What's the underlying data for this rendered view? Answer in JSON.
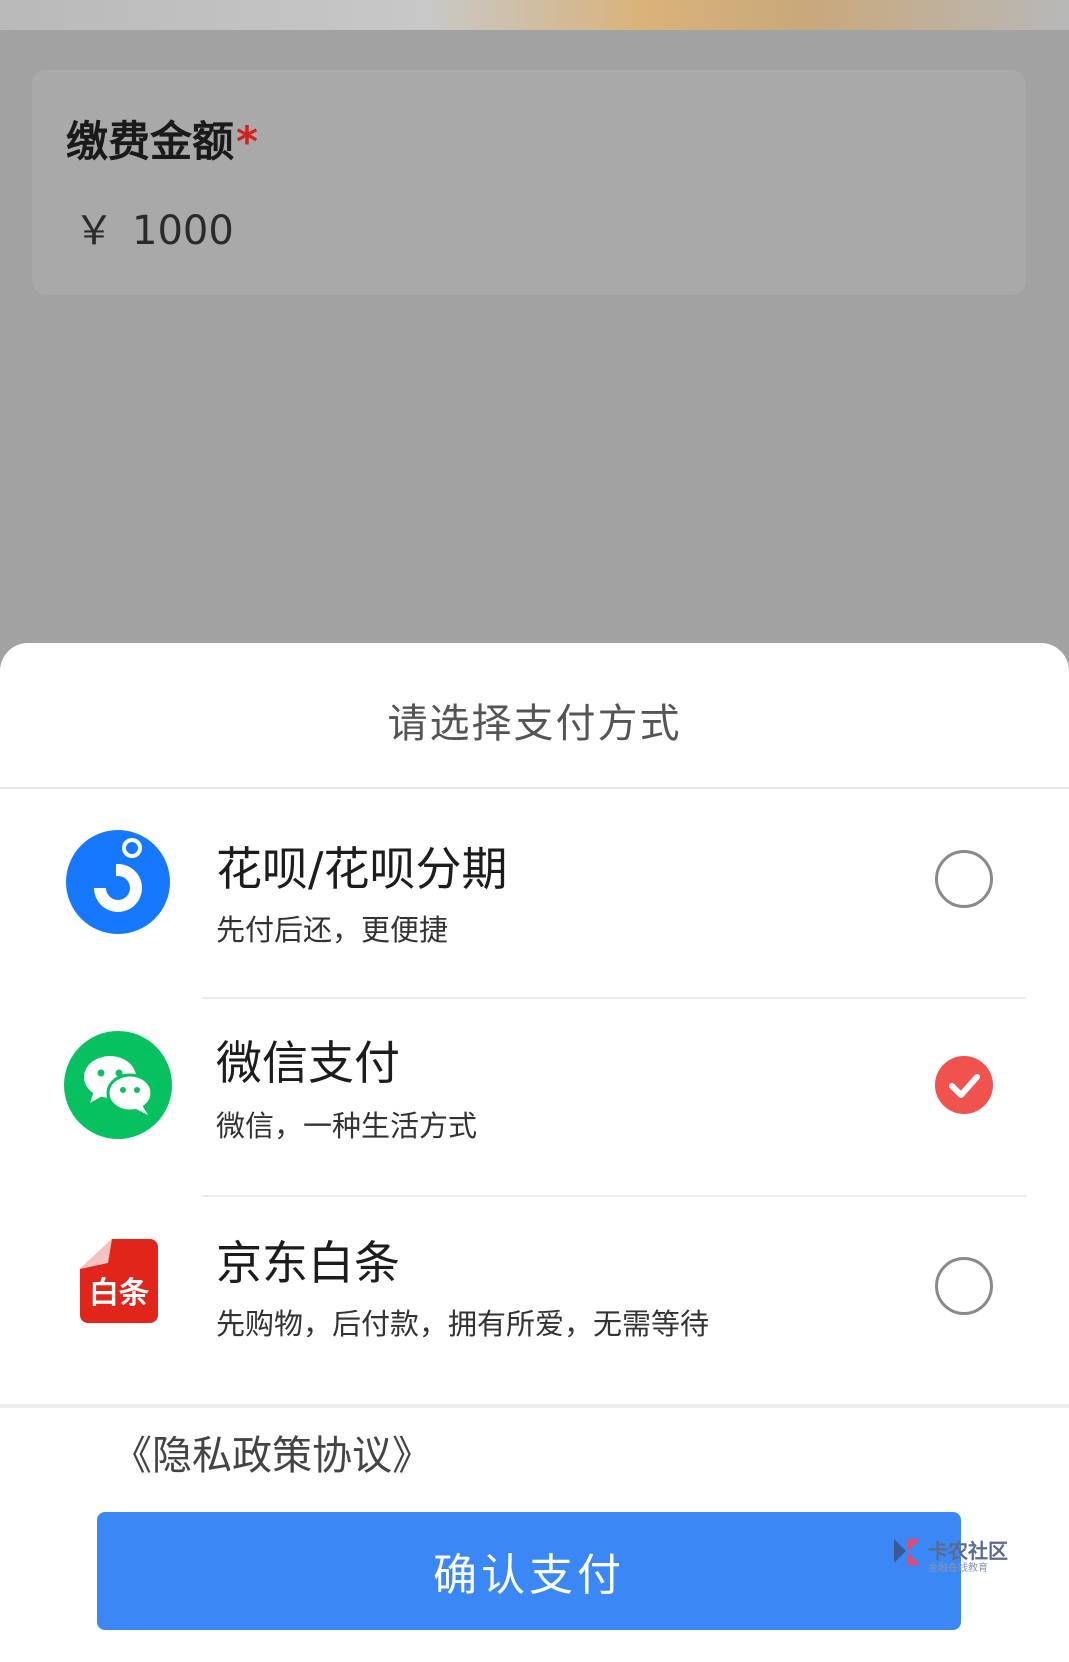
{
  "amount_card": {
    "label": "缴费金额",
    "required_mark": "*",
    "currency": "￥",
    "value": "1000"
  },
  "payment_sheet": {
    "title": "请选择支付方式",
    "methods": [
      {
        "name": "花呗/花呗分期",
        "description": "先付后还，更便捷",
        "selected": false,
        "icon": "huabei-icon"
      },
      {
        "name": "微信支付",
        "description": "微信，一种生活方式",
        "selected": true,
        "icon": "wechat-icon"
      },
      {
        "name": "京东白条",
        "description": "先购物，后付款，拥有所爱，无需等待",
        "selected": false,
        "icon": "jd-baitiao-icon",
        "icon_text": "白条"
      }
    ],
    "privacy_link": "《隐私政策协议》",
    "confirm_label": "确认支付"
  },
  "watermark": {
    "title": "卡农社区",
    "subtitle": "金融在线教育"
  },
  "colors": {
    "accent": "#3a87f5",
    "selected": "#f0524d",
    "wechat": "#07c160",
    "alipay": "#1677ff",
    "jd": "#e1251b"
  }
}
